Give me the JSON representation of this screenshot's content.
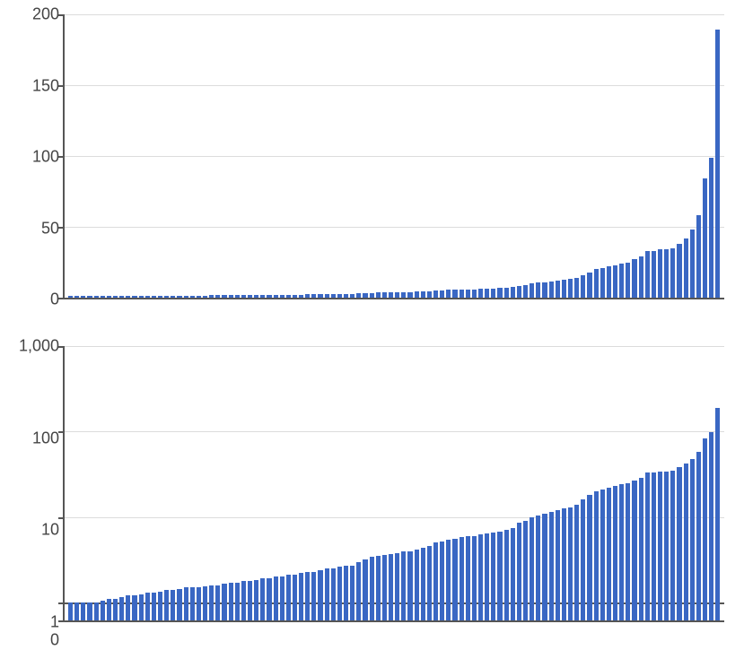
{
  "chart_data": [
    {
      "type": "bar",
      "title": "",
      "xlabel": "",
      "ylabel": "",
      "ylim": [
        0,
        200
      ],
      "y_ticks": [
        0,
        50,
        100,
        150,
        200
      ],
      "values": [
        1.0,
        1.0,
        1.0,
        1.0,
        1.0,
        1.05,
        1.1,
        1.1,
        1.15,
        1.2,
        1.2,
        1.25,
        1.3,
        1.3,
        1.35,
        1.4,
        1.4,
        1.45,
        1.5,
        1.5,
        1.5,
        1.55,
        1.6,
        1.6,
        1.65,
        1.7,
        1.7,
        1.8,
        1.8,
        1.85,
        1.9,
        1.9,
        2.0,
        2.0,
        2.1,
        2.1,
        2.2,
        2.3,
        2.3,
        2.4,
        2.5,
        2.5,
        2.6,
        2.7,
        2.7,
        3.0,
        3.2,
        3.4,
        3.5,
        3.6,
        3.7,
        3.8,
        4.0,
        4.0,
        4.2,
        4.4,
        4.6,
        5.0,
        5.2,
        5.4,
        5.6,
        5.8,
        6.0,
        6.0,
        6.2,
        6.4,
        6.6,
        6.8,
        7.0,
        7.5,
        8.5,
        9.0,
        10.0,
        10.5,
        11.0,
        11.5,
        12.0,
        12.5,
        13.0,
        14.0,
        16.0,
        18.0,
        20.0,
        21.0,
        22.0,
        23.0,
        24.0,
        25.0,
        27.0,
        29.0,
        33.0,
        33.0,
        34.0,
        34.0,
        35.0,
        38.0,
        42.0,
        48.0,
        58.0,
        84.0,
        99.0,
        189.0
      ]
    },
    {
      "type": "bar",
      "title": "",
      "xlabel": "",
      "ylabel": "",
      "yscale": "log",
      "ylim": [
        0,
        1000
      ],
      "y_ticks": [
        0,
        1,
        10,
        100,
        1000
      ],
      "values": [
        1.0,
        1.0,
        1.0,
        1.0,
        1.0,
        1.05,
        1.1,
        1.1,
        1.15,
        1.2,
        1.2,
        1.25,
        1.3,
        1.3,
        1.35,
        1.4,
        1.4,
        1.45,
        1.5,
        1.5,
        1.5,
        1.55,
        1.6,
        1.6,
        1.65,
        1.7,
        1.7,
        1.8,
        1.8,
        1.85,
        1.9,
        1.9,
        2.0,
        2.0,
        2.1,
        2.1,
        2.2,
        2.3,
        2.3,
        2.4,
        2.5,
        2.5,
        2.6,
        2.7,
        2.7,
        3.0,
        3.2,
        3.4,
        3.5,
        3.6,
        3.7,
        3.8,
        4.0,
        4.0,
        4.2,
        4.4,
        4.6,
        5.0,
        5.2,
        5.4,
        5.6,
        5.8,
        6.0,
        6.0,
        6.2,
        6.4,
        6.6,
        6.8,
        7.0,
        7.5,
        8.5,
        9.0,
        10.0,
        10.5,
        11.0,
        11.5,
        12.0,
        12.5,
        13.0,
        14.0,
        16.0,
        18.0,
        20.0,
        21.0,
        22.0,
        23.0,
        24.0,
        25.0,
        27.0,
        29.0,
        33.0,
        33.0,
        34.0,
        34.0,
        35.0,
        38.0,
        42.0,
        48.0,
        58.0,
        84.0,
        99.0,
        189.0
      ]
    }
  ],
  "bar_color": "#3a67c3"
}
